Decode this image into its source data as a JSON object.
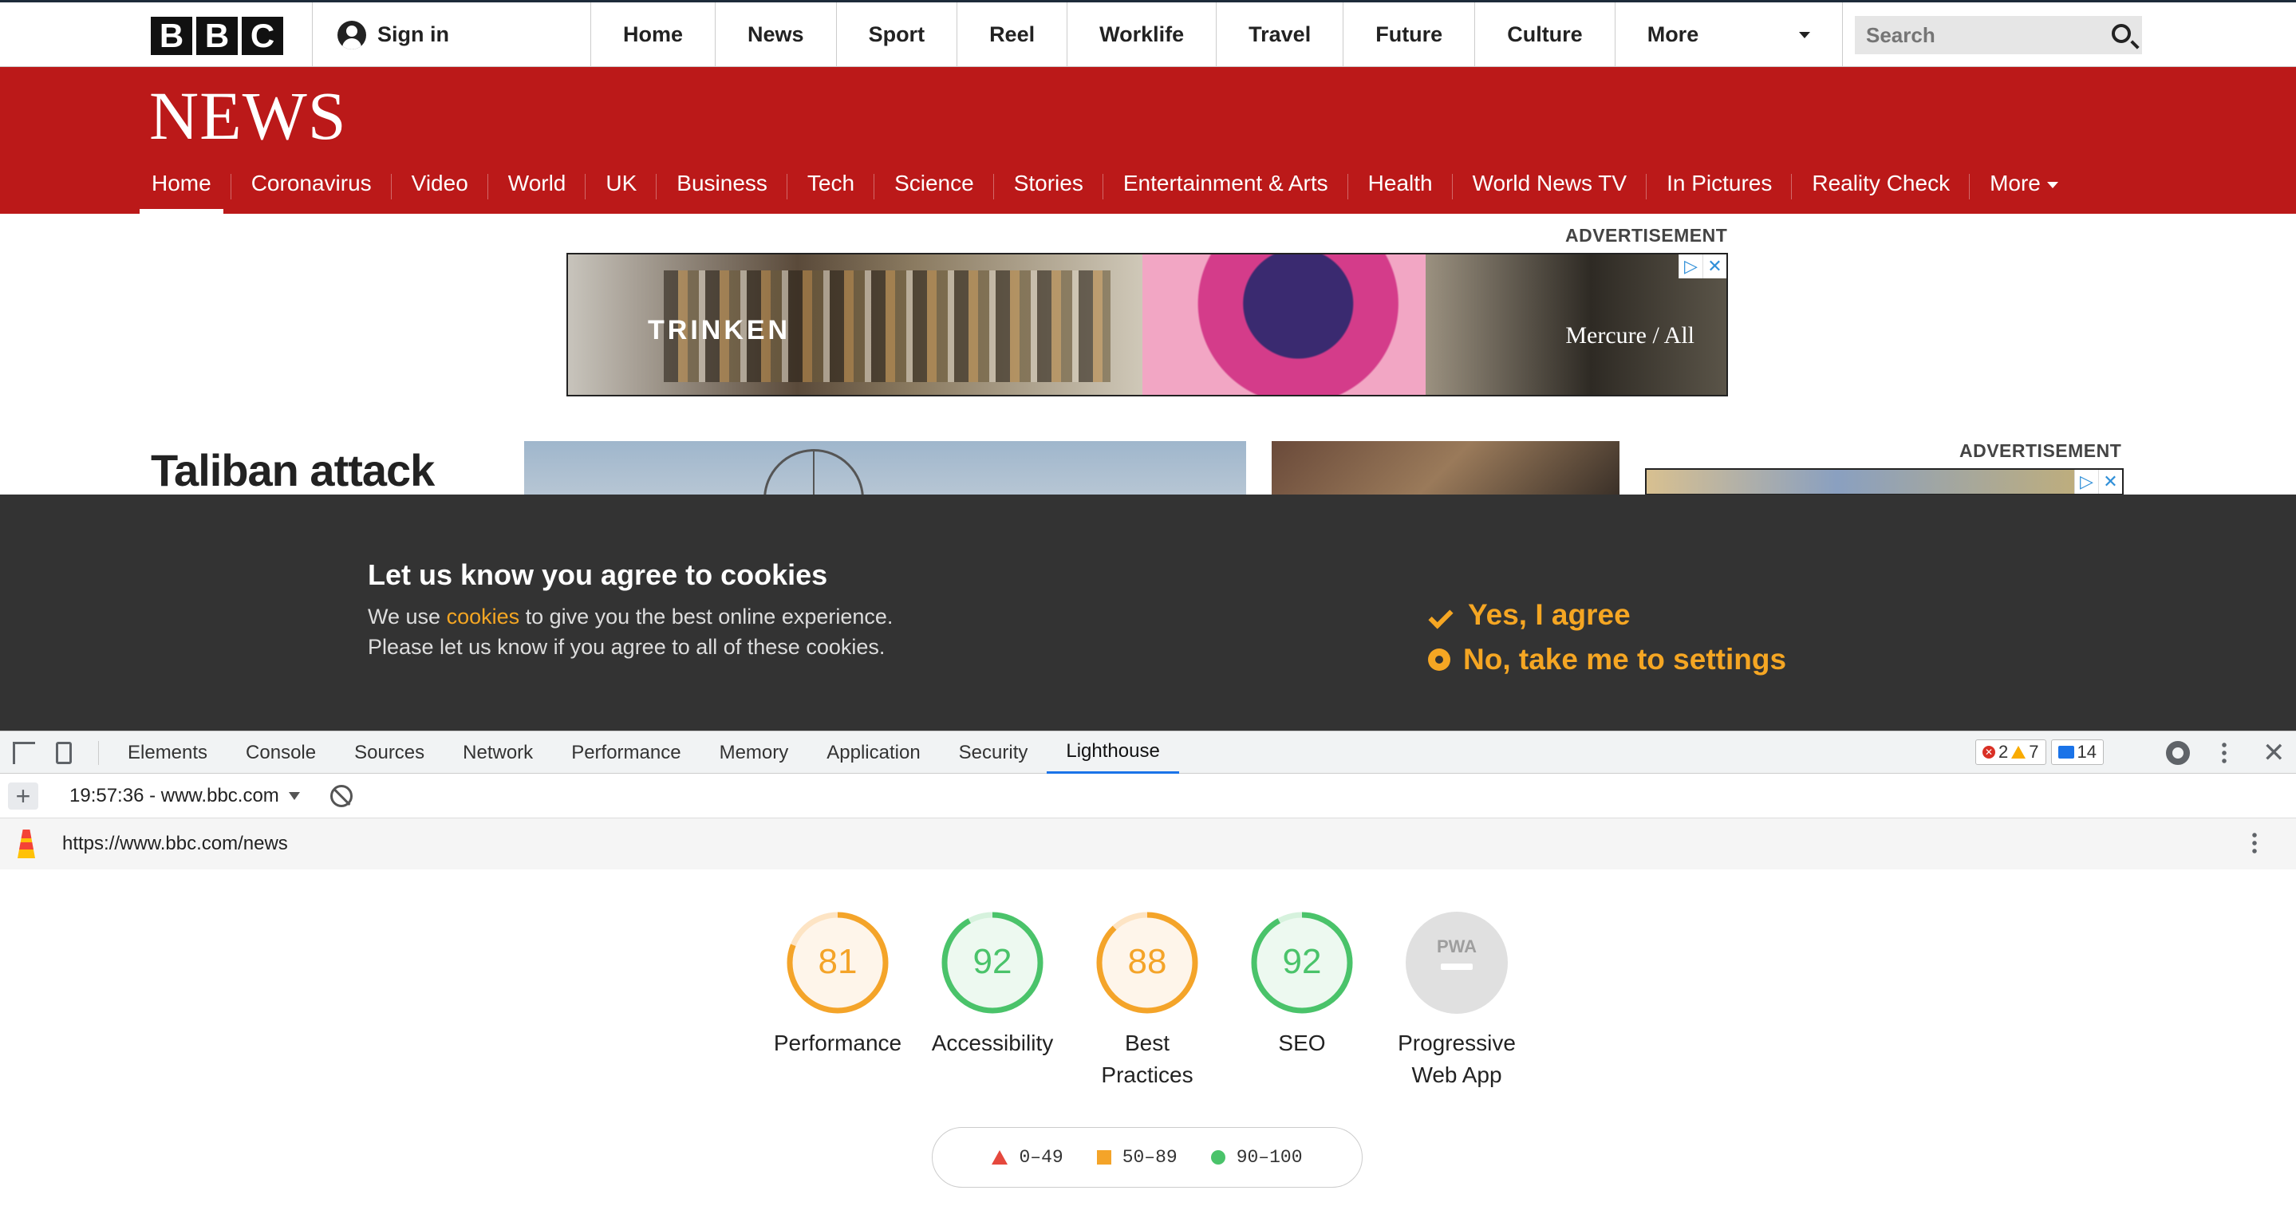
{
  "bbc_header": {
    "logo_letters": [
      "B",
      "B",
      "C"
    ],
    "sign_in": "Sign in",
    "nav": [
      "Home",
      "News",
      "Sport",
      "Reel",
      "Worklife",
      "Travel",
      "Future",
      "Culture"
    ],
    "more": "More",
    "search_placeholder": "Search"
  },
  "news_header": {
    "title": "NEWS",
    "nav": [
      "Home",
      "Coronavirus",
      "Video",
      "World",
      "UK",
      "Business",
      "Tech",
      "Science",
      "Stories",
      "Entertainment & Arts",
      "Health",
      "World News TV",
      "In Pictures",
      "Reality Check"
    ],
    "more": "More",
    "active": "Home"
  },
  "content": {
    "advertisement_label": "ADVERTISEMENT",
    "ad_text_left": "TRINKEN",
    "ad_text_right": "Mercure / All",
    "headline": "Taliban attack"
  },
  "cookie_banner": {
    "title": "Let us know you agree to cookies",
    "line1_before": "We use ",
    "line1_link": "cookies",
    "line1_after": " to give you the best online experience.",
    "line2": "Please let us know if you agree to all of these cookies.",
    "agree": "Yes, I agree",
    "settings": "No, take me to settings"
  },
  "devtools": {
    "tabs": [
      "Elements",
      "Console",
      "Sources",
      "Network",
      "Performance",
      "Memory",
      "Application",
      "Security",
      "Lighthouse"
    ],
    "active_tab": "Lighthouse",
    "errors": "2",
    "warnings": "7",
    "messages": "14",
    "report_label": "19:57:36 - www.bbc.com",
    "url": "https://www.bbc.com/news"
  },
  "lighthouse": {
    "colors": {
      "pass": "#4ac36a",
      "average": "#f4a429",
      "fail": "#e5483d"
    },
    "scores": [
      {
        "label": "Performance",
        "score": "81",
        "value": 81,
        "rating": "average"
      },
      {
        "label": "Accessibility",
        "score": "92",
        "value": 92,
        "rating": "pass"
      },
      {
        "label": "Best Practices",
        "score": "88",
        "value": 88,
        "rating": "average"
      },
      {
        "label": "SEO",
        "score": "92",
        "value": 92,
        "rating": "pass"
      }
    ],
    "pwa": {
      "label": "Progressive Web App",
      "badge": "PWA"
    },
    "legend": [
      "0–49",
      "50–89",
      "90–100"
    ]
  }
}
